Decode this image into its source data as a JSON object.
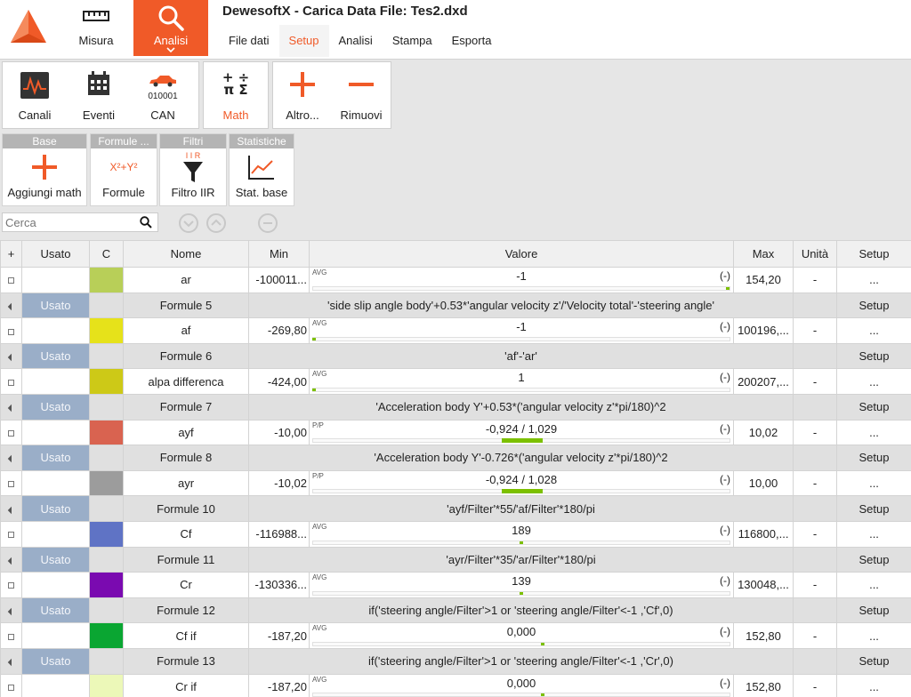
{
  "app": {
    "title": "DewesoftX - Carica Data File: Tes2.dxd",
    "accent": "#f05a28"
  },
  "mode": {
    "misura": "Misura",
    "analisi": "Analisi"
  },
  "menu": [
    "File dati",
    "Setup",
    "Analisi",
    "Stampa",
    "Esporta"
  ],
  "toolbar": {
    "canali": "Canali",
    "eventi": "Eventi",
    "can": "CAN",
    "can_sub": "010001",
    "math": "Math",
    "altro": "Altro...",
    "rimuovi": "Rimuovi"
  },
  "subtoolbar": {
    "groups": [
      {
        "header": "Base",
        "label": "Aggiungi math"
      },
      {
        "header": "Formule ...",
        "label": "Formule",
        "icon_text": "X²+Y²"
      },
      {
        "header": "Filtri",
        "label": "Filtro IIR",
        "icon_text": "I I R"
      },
      {
        "header": "Statistiche",
        "label": "Stat. base"
      }
    ]
  },
  "search": {
    "placeholder": "Cerca"
  },
  "table": {
    "headers": [
      "+",
      "Usato",
      "C",
      "Nome",
      "Min",
      "Valore",
      "Max",
      "Unità",
      "Setup"
    ],
    "rows": [
      {
        "kind": "chan",
        "name": "ar",
        "color": "#b8cf58",
        "min": "-100011...",
        "tag": "AVG",
        "value": "-1",
        "unit": "(-)",
        "max": "154,20",
        "units": "-",
        "setup": "...",
        "mk": 0.995
      },
      {
        "kind": "frm",
        "used": "Usato",
        "name": "Formule 5",
        "expr": "'side slip angle body'+0.53*'angular velocity z'/'Velocity total'-'steering angle'",
        "setup": "Setup"
      },
      {
        "kind": "chan",
        "name": "af",
        "color": "#e6e21a",
        "min": "-269,80",
        "tag": "AVG",
        "value": "-1",
        "unit": "(-)",
        "max": "100196,...",
        "units": "-",
        "setup": "...",
        "mk": 0.003
      },
      {
        "kind": "frm",
        "used": "Usato",
        "name": "Formule 6",
        "expr": "'af'-'ar'",
        "setup": "Setup"
      },
      {
        "kind": "chan",
        "name": "alpa differenca",
        "color": "#cdc917",
        "min": "-424,00",
        "tag": "AVG",
        "value": "1",
        "unit": "(-)",
        "max": "200207,...",
        "units": "-",
        "setup": "...",
        "mk": 0.003
      },
      {
        "kind": "frm",
        "used": "Usato",
        "name": "Formule 7",
        "expr": "'Acceleration body Y'+0.53*('angular velocity z'*pi/180)^2",
        "setup": "Setup"
      },
      {
        "kind": "chan",
        "name": "ayf",
        "color": "#d96350",
        "min": "-10,00",
        "tag": "P/P",
        "value": "-0,924 / 1,029",
        "unit": "(-)",
        "max": "10,02",
        "units": "-",
        "setup": "...",
        "band": [
          0.454,
          0.551
        ]
      },
      {
        "kind": "frm",
        "used": "Usato",
        "name": "Formule 8",
        "expr": "'Acceleration body Y'-0.726*('angular velocity z'*pi/180)^2",
        "setup": "Setup"
      },
      {
        "kind": "chan",
        "name": "ayr",
        "color": "#9c9c9c",
        "min": "-10,02",
        "tag": "P/P",
        "value": "-0,924 / 1,028",
        "unit": "(-)",
        "max": "10,00",
        "units": "-",
        "setup": "...",
        "band": [
          0.454,
          0.551
        ]
      },
      {
        "kind": "frm",
        "used": "Usato",
        "name": "Formule 10",
        "expr": "'ayf/Filter'*55/'af/Filter'*180/pi",
        "setup": "Setup"
      },
      {
        "kind": "chan",
        "name": "Cf",
        "color": "#5f73c5",
        "min": "-116988...",
        "tag": "AVG",
        "value": "189",
        "unit": "(-)",
        "max": "116800,...",
        "units": "-",
        "setup": "...",
        "mk": 0.501
      },
      {
        "kind": "frm",
        "used": "Usato",
        "name": "Formule 11",
        "expr": "'ayr/Filter'*35/'ar/Filter'*180/pi",
        "setup": "Setup"
      },
      {
        "kind": "chan",
        "name": "Cr",
        "color": "#7a0ab0",
        "min": "-130336...",
        "tag": "AVG",
        "value": "139",
        "unit": "(-)",
        "max": "130048,...",
        "units": "-",
        "setup": "...",
        "mk": 0.5
      },
      {
        "kind": "frm",
        "used": "Usato",
        "name": "Formule 12",
        "expr": "if('steering angle/Filter'>1 or 'steering angle/Filter'<-1 ,'Cf',0)",
        "setup": "Setup"
      },
      {
        "kind": "chan",
        "name": "Cf if",
        "color": "#0aa632",
        "min": "-187,20",
        "tag": "AVG",
        "value": "0,000",
        "unit": "(-)",
        "max": "152,80",
        "units": "-",
        "setup": "...",
        "mk": 0.551
      },
      {
        "kind": "frm",
        "used": "Usato",
        "name": "Formule 13",
        "expr": "if('steering angle/Filter'>1 or 'steering angle/Filter'<-1 ,'Cr',0)",
        "setup": "Setup"
      },
      {
        "kind": "chan",
        "name": "Cr if",
        "color": "#ecf8b8",
        "min": "-187,20",
        "tag": "AVG",
        "value": "0,000",
        "unit": "(-)",
        "max": "152,80",
        "units": "-",
        "setup": "...",
        "mk": 0.551
      }
    ]
  }
}
